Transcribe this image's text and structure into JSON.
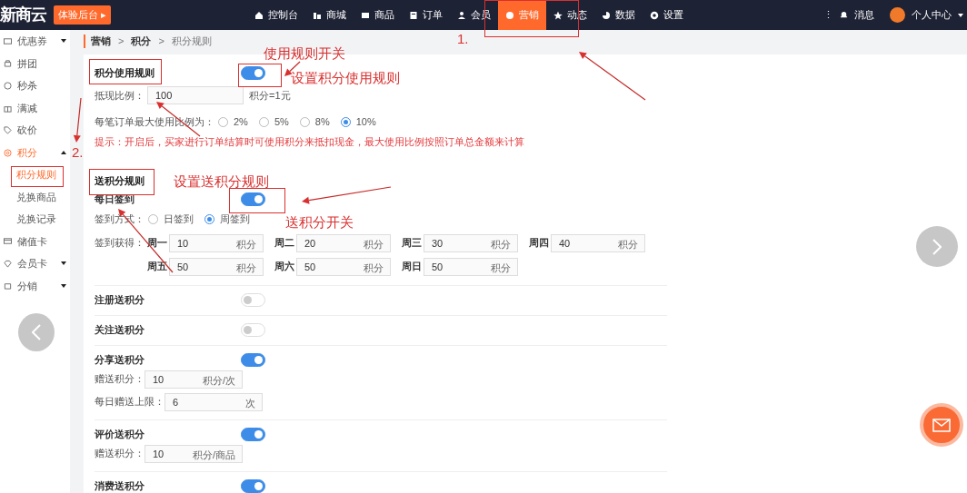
{
  "navbar": {
    "logo": "新商云",
    "trial_button": "体验后台 ▸",
    "items": [
      {
        "label": "控制台",
        "selected": false
      },
      {
        "label": "商城",
        "selected": false
      },
      {
        "label": "商品",
        "selected": false
      },
      {
        "label": "订单",
        "selected": false
      },
      {
        "label": "会员",
        "selected": false
      },
      {
        "label": "营销",
        "selected": true
      },
      {
        "label": "动态",
        "selected": false
      },
      {
        "label": "数据",
        "selected": false
      },
      {
        "label": "设置",
        "selected": false
      }
    ],
    "more": "⋮",
    "messages": "消息",
    "account": "个人中心"
  },
  "sidebar": {
    "items": [
      {
        "kind": "group",
        "label": "优惠券",
        "expanded": false,
        "selected": false
      },
      {
        "kind": "link",
        "label": "拼团",
        "selected": false
      },
      {
        "kind": "link",
        "label": "秒杀",
        "selected": false
      },
      {
        "kind": "link",
        "label": "满减",
        "selected": false
      },
      {
        "kind": "link",
        "label": "砍价",
        "selected": false
      },
      {
        "kind": "group",
        "label": "积分",
        "expanded": true,
        "selected": true,
        "children": [
          {
            "label": "积分规则",
            "selected": true
          },
          {
            "label": "兑换商品",
            "selected": false
          },
          {
            "label": "兑换记录",
            "selected": false
          }
        ]
      },
      {
        "kind": "link",
        "label": "储值卡",
        "selected": false
      },
      {
        "kind": "group",
        "label": "会员卡",
        "expanded": false,
        "selected": false
      },
      {
        "kind": "group",
        "label": "分销",
        "expanded": false,
        "selected": false
      }
    ]
  },
  "breadcrumb": [
    {
      "kind": "link",
      "text": "营销"
    },
    {
      "kind": "separator",
      "text": ">"
    },
    {
      "kind": "link",
      "text": "积分"
    },
    {
      "kind": "separator",
      "text": ">"
    },
    {
      "kind": "current",
      "text": "积分规则"
    }
  ],
  "usage_rules": {
    "title": "积分使用规则",
    "enabled": true,
    "ratio": {
      "label": "抵现比例：",
      "value": "100",
      "unit": "积分=1元"
    },
    "max_ratio": {
      "label": "每笔订单最大使用比例为：",
      "options": [
        {
          "label": "2%",
          "selected": false
        },
        {
          "label": "5%",
          "selected": false
        },
        {
          "label": "8%",
          "selected": false
        },
        {
          "label": "10%",
          "selected": true
        }
      ]
    },
    "hint": "提示：开启后，买家进行订单结算时可使用积分来抵扣现金，最大使用比例按照订单总金额来计算"
  },
  "gift_rules": {
    "title": "送积分规则",
    "items": [
      {
        "kind": "checkin",
        "title": "每日签到",
        "enabled": true,
        "mode": {
          "label": "签到方式：",
          "options": [
            {
              "label": "日签到",
              "selected": false
            },
            {
              "label": "周签到",
              "selected": true
            }
          ]
        },
        "rewards": {
          "label": "签到获得：",
          "days": [
            {
              "day": "周一",
              "value": "10",
              "unit": "积分"
            },
            {
              "day": "周二",
              "value": "20",
              "unit": "积分"
            },
            {
              "day": "周三",
              "value": "30",
              "unit": "积分"
            },
            {
              "day": "周四",
              "value": "40",
              "unit": "积分"
            },
            {
              "day": "周五",
              "value": "50",
              "unit": "积分"
            },
            {
              "day": "周六",
              "value": "50",
              "unit": "积分"
            },
            {
              "day": "周日",
              "value": "50",
              "unit": "积分"
            }
          ]
        }
      },
      {
        "kind": "simple",
        "title": "注册送积分",
        "enabled": false
      },
      {
        "kind": "simple",
        "title": "关注送积分",
        "enabled": false
      },
      {
        "kind": "fields",
        "title": "分享送积分",
        "enabled": true,
        "fields": [
          {
            "label": "赠送积分：",
            "value": "10",
            "unit": "积分/次"
          },
          {
            "label": "每日赠送上限：",
            "value": "6",
            "unit": "次"
          }
        ]
      },
      {
        "kind": "fields",
        "title": "评价送积分",
        "enabled": true,
        "fields": [
          {
            "label": "赠送积分：",
            "value": "10",
            "unit": "积分/商品"
          }
        ]
      },
      {
        "kind": "simple",
        "title": "消费送积分",
        "enabled": true
      }
    ]
  },
  "annotations": {
    "labels": [
      "1.",
      "使用规则开关",
      "设置积分使用规则",
      "2.",
      "设置送积分规则",
      "送积分开关"
    ]
  }
}
